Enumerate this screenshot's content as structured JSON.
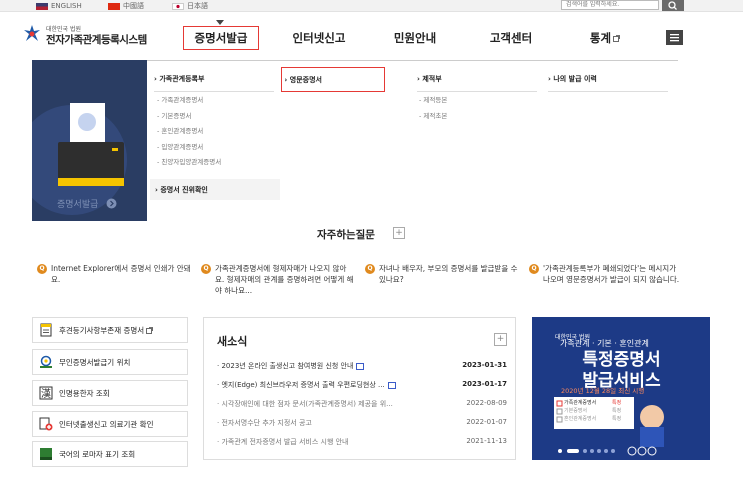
{
  "topbar": {
    "languages": [
      {
        "label": "ENGLISH"
      },
      {
        "label": "中國語"
      },
      {
        "label": "日本語"
      }
    ],
    "search_placeholder": "검색어를 입력하세요."
  },
  "header": {
    "logo_small": "대한민국 법원",
    "logo_big": "전자가족관계등록시스템",
    "nav": [
      {
        "label": "증명서발급"
      },
      {
        "label": "인터넷신고"
      },
      {
        "label": "민원안내"
      },
      {
        "label": "고객센터"
      },
      {
        "label": "통계"
      }
    ]
  },
  "mega_menu": {
    "left_caption": "증명서발급",
    "columns": [
      {
        "heading": "가족관계등록부",
        "items": [
          "가족관계증명서",
          "기본증명서",
          "혼인관계증명서",
          "입양관계증명서",
          "친양자입양관계증명서"
        ]
      },
      {
        "heading": "영문증명서",
        "items": []
      },
      {
        "heading": "제적부",
        "items": [
          "제적등본",
          "제적초본"
        ]
      },
      {
        "heading": "나의 발급 이력",
        "items": []
      }
    ],
    "verify_label": "증명서 진위확인"
  },
  "faq": {
    "title": "자주하는질문",
    "items": [
      {
        "marker": "Q",
        "text": "Internet Explorer에서 증명서 인쇄가 안돼요."
      },
      {
        "marker": "Q",
        "text": "가족관계증명서에 형제자매가 나오지 않아요. 형제자매의 관계를 증명하려면 어떻게 해야 하나요..."
      },
      {
        "marker": "Q",
        "text": "자녀나 배우자, 부모의 증명서를 발급받을 수 있나요?"
      },
      {
        "marker": "Q",
        "text": "'가족관계등록부가 폐쇄되었다'는 메시지가 나오며 영문증명서가 발급이 되지 않습니다."
      }
    ]
  },
  "quick_links": [
    {
      "label": "후견등기사항부존재 증명서"
    },
    {
      "label": "무인증명서발급기 위치"
    },
    {
      "label": "인명용한자 조회"
    },
    {
      "label": "인터넷출생신고 의료기관 확인"
    },
    {
      "label": "국어의 로마자 표기 조회"
    }
  ],
  "news": {
    "title": "새소식",
    "items": [
      {
        "title": "2023년 온라인 출생신고 참여병원 신청 안내",
        "date": "2023-01-31",
        "is_new": true
      },
      {
        "title": "엣지(Edge) 최신브라우저 증명서 출력 우편로딩현상 ...",
        "date": "2023-01-17",
        "is_new": true
      },
      {
        "title": "시각장애인에 대한 점자 문서(가족관계증명서) 제공을 위...",
        "date": "2022-08-09",
        "is_new": false
      },
      {
        "title": "전자서명수단 추가 지정서 공고",
        "date": "2022-01-07",
        "is_new": false
      },
      {
        "title": "가족관계 전자증명서 발급 서비스 시행 안내",
        "date": "2021-11-13",
        "is_new": false
      }
    ]
  },
  "banner": {
    "org": "대한민국 법원",
    "subtitle": "가족관계 · 기본 · 혼인관계",
    "headline1": "특정증명서",
    "headline2": "발급서비스",
    "date_note": "2020년 12월 28일 최신 시행",
    "check_labels": [
      "가족관계증명서",
      "기본증명서",
      "혼인관계증명서"
    ],
    "check_tags": [
      "특정",
      "특정",
      "특정"
    ]
  },
  "colors": {
    "nav_highlight": "#e53935",
    "faq_icon": "#e08a1e",
    "banner_bg": "#1d3a86",
    "menu_left_bg": "#2a3d63"
  }
}
